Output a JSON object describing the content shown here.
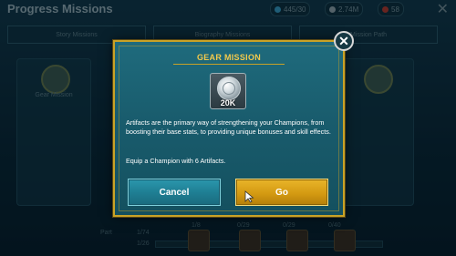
{
  "background": {
    "title": "Progress Missions",
    "resources": [
      "445/30",
      "2.74M",
      "58"
    ],
    "tabs": [
      "Story Missions",
      "Biography Missions",
      "Mission Path"
    ],
    "card_label": "Gear Mission",
    "progress_rows": [
      "Part",
      "1/74",
      "1/26"
    ],
    "progress_counts": [
      "1/8",
      "0/29",
      "0/29",
      "0/40"
    ]
  },
  "modal": {
    "title": "GEAR MISSION",
    "reward": {
      "icon": "silver-coin-icon",
      "amount": "20K"
    },
    "description": "Artifacts are the primary way of strengthening your Champions, from boosting their base stats, to providing unique bonuses and skill effects.",
    "requirement": "Equip a Champion with 6 Artifacts.",
    "cancel_label": "Cancel",
    "go_label": "Go",
    "close_symbol": "✕"
  },
  "colors": {
    "panel": "#1f6b7d",
    "frame_gold": "#c9a227",
    "title_gold": "#f2c94c",
    "cancel_button": "#1f7f94",
    "go_button": "#d49a12"
  }
}
